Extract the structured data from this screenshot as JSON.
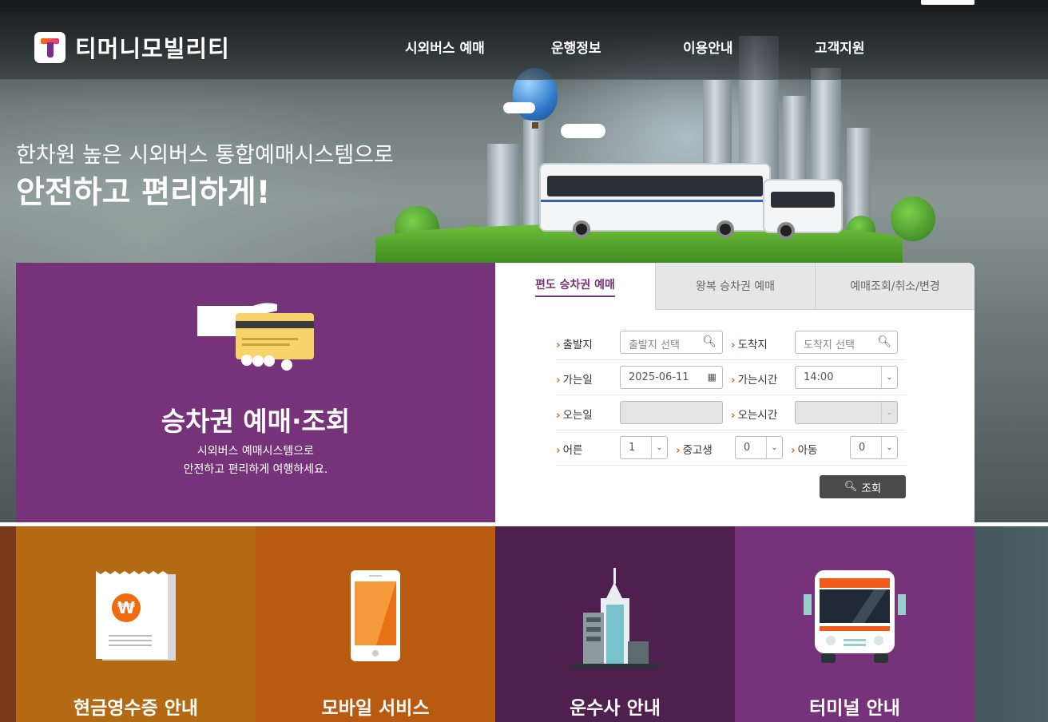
{
  "header": {
    "logo_text": "티머니모빌리티",
    "nav": [
      "시외버스 예매",
      "운행정보",
      "이용안내",
      "고객지원"
    ]
  },
  "hero": {
    "subtitle": "한차원 높은 시외버스 통합예매시스템으로",
    "title": "안전하고 편리하게!"
  },
  "promo": {
    "title": "승차권 예매·조회",
    "desc_line1": "시외버스 예매시스템으로",
    "desc_line2": "안전하고 편리하게 여행하세요."
  },
  "booking": {
    "tabs": [
      "편도 승차권 예매",
      "왕복 승차권 예매",
      "예매조회/취소/변경"
    ],
    "active_tab": 0,
    "departure_label": "출발지",
    "departure_placeholder": "출발지 선택",
    "arrival_label": "도착지",
    "arrival_placeholder": "도착지 선택",
    "go_date_label": "가는일",
    "go_date_value": "2025-06-11",
    "go_time_label": "가는시간",
    "go_time_value": "14:00",
    "return_date_label": "오는일",
    "return_date_value": "",
    "return_time_label": "오는시간",
    "return_time_value": "",
    "adult_label": "어른",
    "adult_value": "1",
    "youth_label": "중고생",
    "youth_value": "0",
    "child_label": "아동",
    "child_value": "0",
    "search_label": "조회"
  },
  "tiles": [
    {
      "label": "현금영수증 안내",
      "color": "#b46a12",
      "icon": "receipt-icon"
    },
    {
      "label": "모바일 서비스",
      "color": "#b85a10",
      "icon": "mobile-icon"
    },
    {
      "label": "운수사 안내",
      "color": "#4f1f4e",
      "icon": "building-icon"
    },
    {
      "label": "터미널 안내",
      "color": "#773379",
      "icon": "bus-icon"
    }
  ]
}
